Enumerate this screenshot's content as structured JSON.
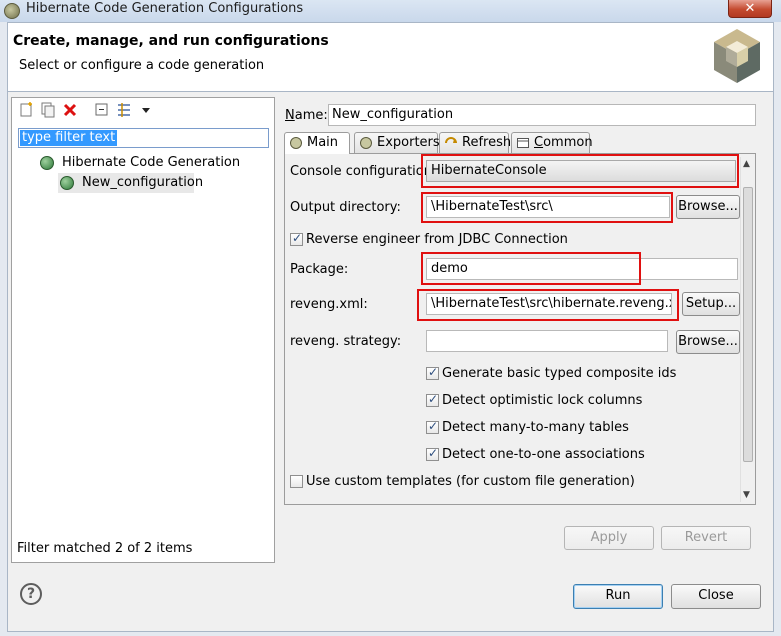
{
  "window": {
    "title": "Hibernate Code Generation Configurations",
    "close_glyph": "✕"
  },
  "header": {
    "title": "Create, manage, and run configurations",
    "subtitle": "Select or configure a code generation"
  },
  "left": {
    "filter_text": "type filter text",
    "toolbar_icons": [
      "new-config-icon",
      "duplicate-icon",
      "delete-icon",
      "collapse-all-icon",
      "filter-icon",
      "dropdown-arrow-icon"
    ],
    "tree": [
      {
        "label": "Hibernate Code Generation",
        "level": 0
      },
      {
        "label": "New_configuration",
        "level": 1,
        "selected": true
      }
    ],
    "status": "Filter matched 2 of 2 items"
  },
  "right": {
    "name_label": "Name:",
    "name_value": "New_configuration",
    "tabs": [
      {
        "label": "Main",
        "icon": "main-tab-icon",
        "active": true
      },
      {
        "label": "Exporters",
        "icon": "exporters-tab-icon"
      },
      {
        "label": "Refresh",
        "icon": "refresh-tab-icon"
      },
      {
        "label": "Common",
        "icon": "common-tab-icon"
      }
    ],
    "main": {
      "console_config_label": "Console configuration:",
      "console_config_value": "HibernateConsole",
      "output_dir_label": "Output directory:",
      "output_dir_value": "\\HibernateTest\\src\\",
      "browse_label": "Browse...",
      "reverse_engineer_label": "Reverse engineer from JDBC Connection",
      "reverse_engineer_checked": true,
      "package_label": "Package:",
      "package_value": "demo",
      "reveng_xml_label": "reveng.xml:",
      "reveng_xml_value": "\\HibernateTest\\src\\hibernate.reveng.xml",
      "setup_label": "Setup...",
      "reveng_strategy_label": "reveng. strategy:",
      "reveng_strategy_value": "",
      "browse2_label": "Browse...",
      "options": [
        {
          "label": "Generate basic typed composite ids",
          "checked": true
        },
        {
          "label": "Detect optimistic lock columns",
          "checked": true
        },
        {
          "label": "Detect many-to-many tables",
          "checked": true
        },
        {
          "label": "Detect one-to-one associations",
          "checked": true
        }
      ],
      "custom_templates_label": "Use custom templates (for custom file generation)",
      "custom_templates_checked": false
    },
    "apply_label": "Apply",
    "revert_label": "Revert"
  },
  "footer": {
    "help_glyph": "?",
    "run_label": "Run",
    "close_label": "Close"
  }
}
